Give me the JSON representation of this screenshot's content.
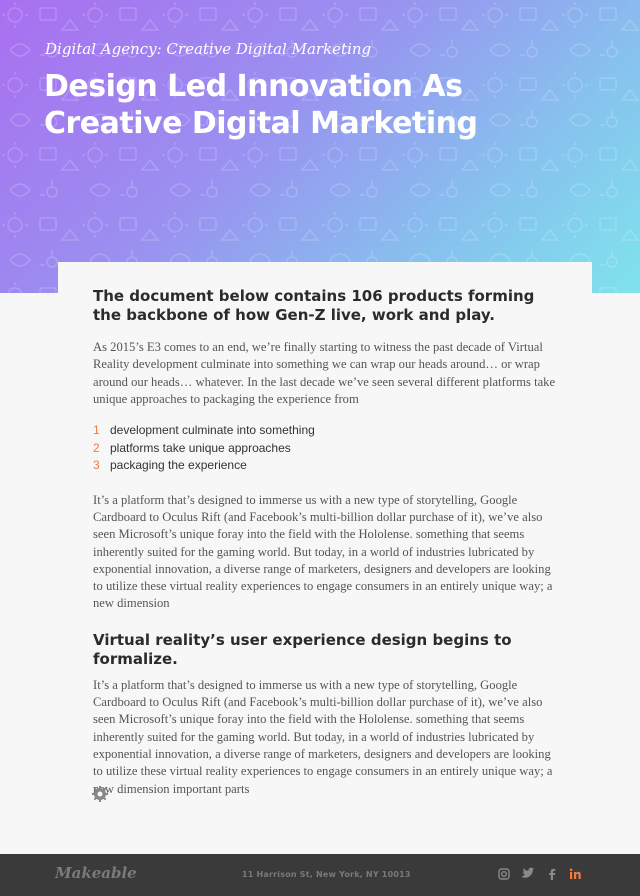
{
  "hero": {
    "eyebrow": "Digital Agency: Creative Digital Marketing",
    "title": "Design Led Innovation As Creative Digital Marketing",
    "gradient_colors": [
      "#a96ff0",
      "#86c4ee",
      "#7fe3ec"
    ]
  },
  "article": {
    "lead": "The document below contains 106 products forming the backbone of how Gen-Z live, work and play.",
    "intro": "As 2015’s E3 comes to an end, we’re finally starting to witness the past decade of Virtual Reality development culminate into something we can wrap our heads around… or wrap around our heads… whatever. In the last decade we’ve seen several different platforms take unique approaches to packaging the experience from",
    "list": [
      {
        "num": "1",
        "text": "development culminate into something"
      },
      {
        "num": "2",
        "text": "platforms take unique approaches"
      },
      {
        "num": "3",
        "text": "packaging the experience"
      }
    ],
    "para2": "It’s a platform that’s designed to immerse us with a new type of storytelling, Google Cardboard to Oculus Rift (and Facebook’s multi-billion dollar purchase of it), we’ve also seen Microsoft’s unique foray into the field with the Hololense. something that seems inherently suited for the gaming world. But today, in a world of industries lubricated by exponential innovation, a diverse range of marketers, designers and developers are looking to utilize these virtual reality experiences to engage consumers in an entirely unique way; a new dimension",
    "heading2": "Virtual reality’s user experience design begins to formalize.",
    "para3": "It’s a platform that’s designed to immerse us with a new type of storytelling, Google Cardboard to Oculus Rift (and Facebook’s multi-billion dollar purchase of it), we’ve also seen Microsoft’s unique foray into the field with the Hololense. something that seems inherently suited for the gaming world. But today, in a world of industries lubricated by exponential innovation, a diverse range of marketers, designers and developers are looking to utilize these virtual reality experiences to engage consumers in an entirely unique way; a new dimension important parts",
    "accent_color": "#f07b3f",
    "end_icon": "gear-icon"
  },
  "footer": {
    "logo": "Makeable",
    "address": "11 Harrison St, New York, NY 10013",
    "social_icons": [
      "instagram-icon",
      "twitter-icon",
      "facebook-icon",
      "linkedin-icon"
    ],
    "linkedin_color": "#f07b3f"
  }
}
